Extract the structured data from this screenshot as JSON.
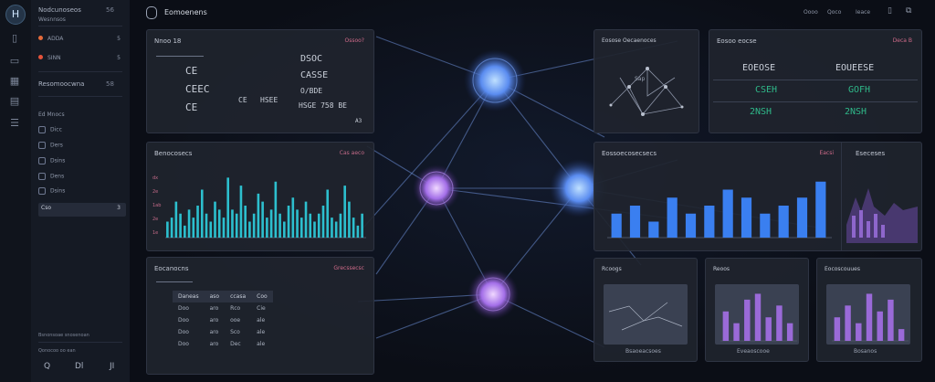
{
  "rail": {
    "logo": "H",
    "icons": [
      "panel-icon",
      "layers-icon",
      "grid-icon",
      "stack-icon"
    ]
  },
  "sidebar": {
    "workspace": "Nodcunoseos",
    "workspace_badge": "56",
    "section_label": "Wesnnsos",
    "items": [
      {
        "label": "ADDA",
        "badge": "5"
      },
      {
        "label": "SINN",
        "badge": "5"
      }
    ],
    "group": {
      "label": "Resomoocwna",
      "badge": "58"
    },
    "sub_title": "Ed Mnocs",
    "sub_items": [
      "Dicc",
      "Ders",
      "Dsins",
      "Dens",
      "Dsins"
    ],
    "active": {
      "label": "Cso",
      "badge": "3"
    },
    "footer_line1": "Bsnonsoae snosenoan",
    "footer_line2": "Qonocoo oo ean",
    "footer_icons": [
      "Q",
      "Dl",
      "JI"
    ]
  },
  "topbar": {
    "title": "Eomoenens",
    "links": [
      "Oooo",
      "Qoco",
      "Ieace"
    ],
    "icons": [
      "doc-icon",
      "copy-icon"
    ]
  },
  "panels": {
    "top_left": {
      "title": "Nnoo 18",
      "right": "Ossoo?",
      "rows": [
        "CE",
        "CEEC",
        "CE",
        "CE"
      ],
      "right_rows": [
        "DSOC",
        "CASSE",
        "O/BDE",
        "HSGE 758 BE"
      ],
      "mid_labels": [
        "CE",
        "HSEE"
      ],
      "foot": "A3"
    },
    "mid_left": {
      "title": "Benocosecs",
      "right": "Cas aeco",
      "y_ticks": [
        "dx",
        "2e",
        "1ab",
        "2e",
        "1e"
      ]
    },
    "bottom_left": {
      "title": "Eocanocns",
      "right": "Grecssecsc",
      "head": [
        "Daneas",
        "aso",
        "ccasa",
        "Coo"
      ],
      "rows": [
        [
          "Doo",
          "aro",
          "Rco",
          "Cie"
        ],
        [
          "Doo",
          "aro",
          "ooe",
          "ale"
        ],
        [
          "Doo",
          "aro",
          "Sco",
          "ale"
        ],
        [
          "Doo",
          "aro",
          "Dec",
          "ale"
        ]
      ]
    },
    "graph_small": {
      "title": "Eosose Oecaenoces",
      "value": "Sap"
    },
    "kpi": {
      "title": "Eosoo eocse",
      "right": "Deca B",
      "row1": [
        "EOEOSE",
        "EOUEESE"
      ],
      "row2": [
        "CSEH",
        "GOFH"
      ],
      "row3": [
        "2NSH",
        "2NSH"
      ]
    },
    "center_right": {
      "title": "Eossoecosecsecs",
      "right": "Eacsi",
      "side_title": "Eseceses"
    },
    "b1": {
      "title": "Rcoogs",
      "caption": "Bsaoeacsoes"
    },
    "b2": {
      "title": "Reoos",
      "caption": "Eveaoscooe"
    },
    "b3": {
      "title": "Eocoscouues",
      "caption": "Bosanos"
    }
  },
  "chart_data": [
    {
      "type": "bar",
      "title": "Benocosecs",
      "series": [
        {
          "values": [
            4,
            5,
            9,
            6,
            3,
            7,
            5,
            8,
            12,
            6,
            4,
            9,
            7,
            5,
            15,
            7,
            6,
            13,
            8,
            4,
            6,
            11,
            9,
            5,
            7,
            14,
            6,
            4,
            8,
            10,
            7,
            5,
            9,
            6,
            4,
            6,
            8,
            12,
            5,
            4,
            6,
            13,
            9,
            5,
            3,
            6
          ]
        }
      ],
      "ylim": [
        0,
        16
      ]
    },
    {
      "type": "bar",
      "title": "Eossoecosecsecs",
      "series": [
        {
          "values": [
            3,
            4,
            2,
            5,
            3,
            4,
            6,
            5,
            3,
            4,
            5,
            7
          ]
        }
      ],
      "ylim": [
        0,
        8
      ]
    },
    {
      "type": "bar",
      "title": "Reoos",
      "series": [
        {
          "values": [
            5,
            3,
            7,
            8,
            4,
            6,
            3
          ]
        }
      ],
      "ylim": [
        0,
        9
      ]
    },
    {
      "type": "bar",
      "title": "Eocoscouues",
      "series": [
        {
          "values": [
            4,
            6,
            3,
            8,
            5,
            7,
            2
          ]
        }
      ],
      "ylim": [
        0,
        9
      ]
    }
  ],
  "colors": {
    "accent": "#d06b8a",
    "teal": "#2fd0e0",
    "blue": "#3a7ff0",
    "purple": "#9a6ad8",
    "green": "#2fb889"
  }
}
